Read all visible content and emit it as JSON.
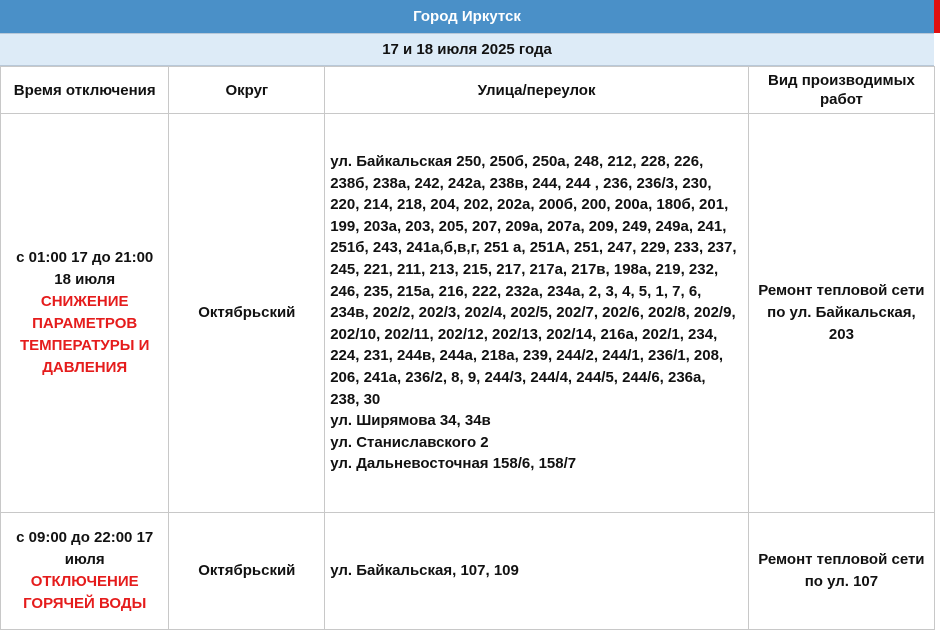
{
  "title": "Город Иркутск",
  "date": "17 и 18 июля 2025 года",
  "colors": {
    "title_bg": "#4a90c8",
    "date_bg": "#ddebf7",
    "alert_red": "#e51c1c"
  },
  "headers": [
    "Время отключения",
    "Округ",
    "Улица/переулок",
    "Вид производимых работ"
  ],
  "rows": [
    {
      "time": "с 01:00 17 до 21:00 18 июля",
      "alert": "СНИЖЕНИЕ ПАРАМЕТРОВ ТЕМПЕРАТУРЫ И ДАВЛЕНИЯ",
      "district": "Октябрьский",
      "streets": [
        "ул. Байкальская 250, 250б, 250а, 248, 212, 228, 226, 238б, 238а, 242, 242а, 238в, 244, 244 , 236, 236/3, 230, 220, 214, 218, 204, 202, 202а, 200б, 200, 200а, 180б, 201, 199, 203а, 203, 205, 207, 209а, 207а, 209, 249, 249а, 241, 251б, 243, 241а,б,в,г, 251 а, 251А, 251, 247, 229, 233, 237, 245, 221, 211, 213, 215, 217, 217а, 217в, 198а, 219, 232, 246, 235, 215а, 216, 222, 232а, 234а, 2, 3, 4, 5, 1, 7, 6, 234в, 202/2, 202/3, 202/4, 202/5, 202/7, 202/6, 202/8, 202/9, 202/10, 202/11, 202/12, 202/13, 202/14, 216а, 202/1, 234, 224, 231, 244в, 244а, 218а, 239, 244/2, 244/1, 236/1, 208, 206, 241а, 236/2, 8, 9, 244/3, 244/4, 244/5, 244/6, 236а, 238, 30",
        "ул. Ширямова 34, 34в",
        "ул. Станиславского 2",
        "ул. Дальневосточная 158/6, 158/7"
      ],
      "work": "Ремонт тепловой сети по ул. Байкальская, 203"
    },
    {
      "time": "с 09:00 до 22:00 17 июля",
      "alert": "ОТКЛЮЧЕНИЕ ГОРЯЧЕЙ ВОДЫ",
      "district": "Октябрьский",
      "streets": [
        "ул. Байкальская, 107, 109"
      ],
      "work": "Ремонт тепловой сети по ул. 107"
    }
  ]
}
